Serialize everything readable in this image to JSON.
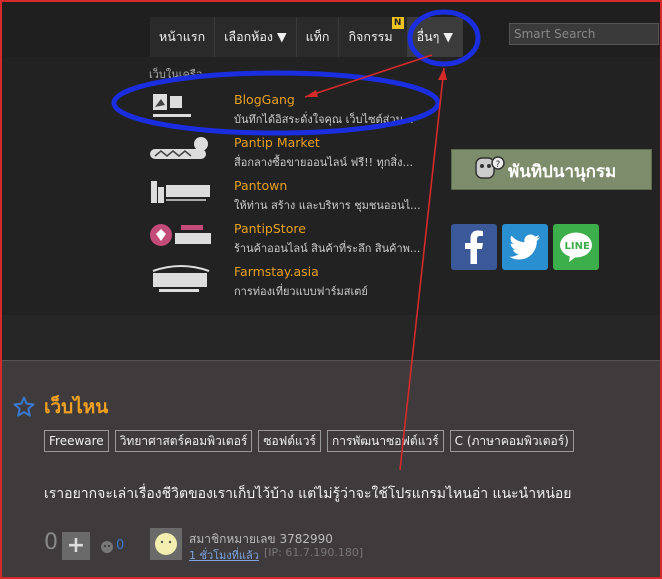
{
  "nav": {
    "items": [
      {
        "label": "หน้าแรก"
      },
      {
        "label": "เลือกห้อง ▼"
      },
      {
        "label": "แท็ก"
      },
      {
        "label": "กิจกรรม",
        "badge": "N"
      },
      {
        "label": "อื่นๆ ▼"
      }
    ],
    "search_placeholder": "Smart Search"
  },
  "dropdown": {
    "heading": "เว็บในเครือ",
    "sites": [
      {
        "name": "BlogGang",
        "desc": "บันทึกได้อิสระดั่งใจคุณ เว็บไซต์ส่วน..."
      },
      {
        "name": "Pantip Market",
        "desc": "สื่อกลางซื้อขายออนไลน์ ฟรี!! ทุกสิ่ง..."
      },
      {
        "name": "Pantown",
        "desc": "ให้ท่าน สร้าง และบริหาร ชุมชนออนไ..."
      },
      {
        "name": "PantipStore",
        "desc": "ร้านค้าออนไลน์ สินค้าที่ระลึก สินค้าพ..."
      },
      {
        "name": "Farmstay.asia",
        "desc": "การท่องเที่ยวแบบฟาร์มสเตย์"
      }
    ],
    "banner_text": "พันทิปนานุกรม",
    "social": [
      "facebook-icon",
      "twitter-icon",
      "line-icon"
    ],
    "line_label": "LINE"
  },
  "topic": {
    "title": "เว็บไหน",
    "tags": [
      "Freeware",
      "วิทยาศาสตร์คอมพิวเตอร์",
      "ซอฟต์แวร์",
      "การพัฒนาซอฟต์แวร์",
      "C (ภาษาคอมพิวเตอร์)"
    ],
    "body": "เราอยากจะเล่าเรื่องชีวิตของเราเก็บไว้บ้าง แต่ไม่รู้ว่าจะใช้โปรแกรมไหนอ่า แนะนำหน่อย",
    "votes": "0",
    "emotion_count": "0",
    "member": "สมาชิกหมายเลข 3782990",
    "time": "1 ชั่วโมงที่แล้ว",
    "ip": "[IP: 61.7.190.180]"
  },
  "colors": {
    "accent": "#f0a020",
    "annotation_red": "#d42a2a",
    "annotation_blue": "#1a2ee0"
  }
}
